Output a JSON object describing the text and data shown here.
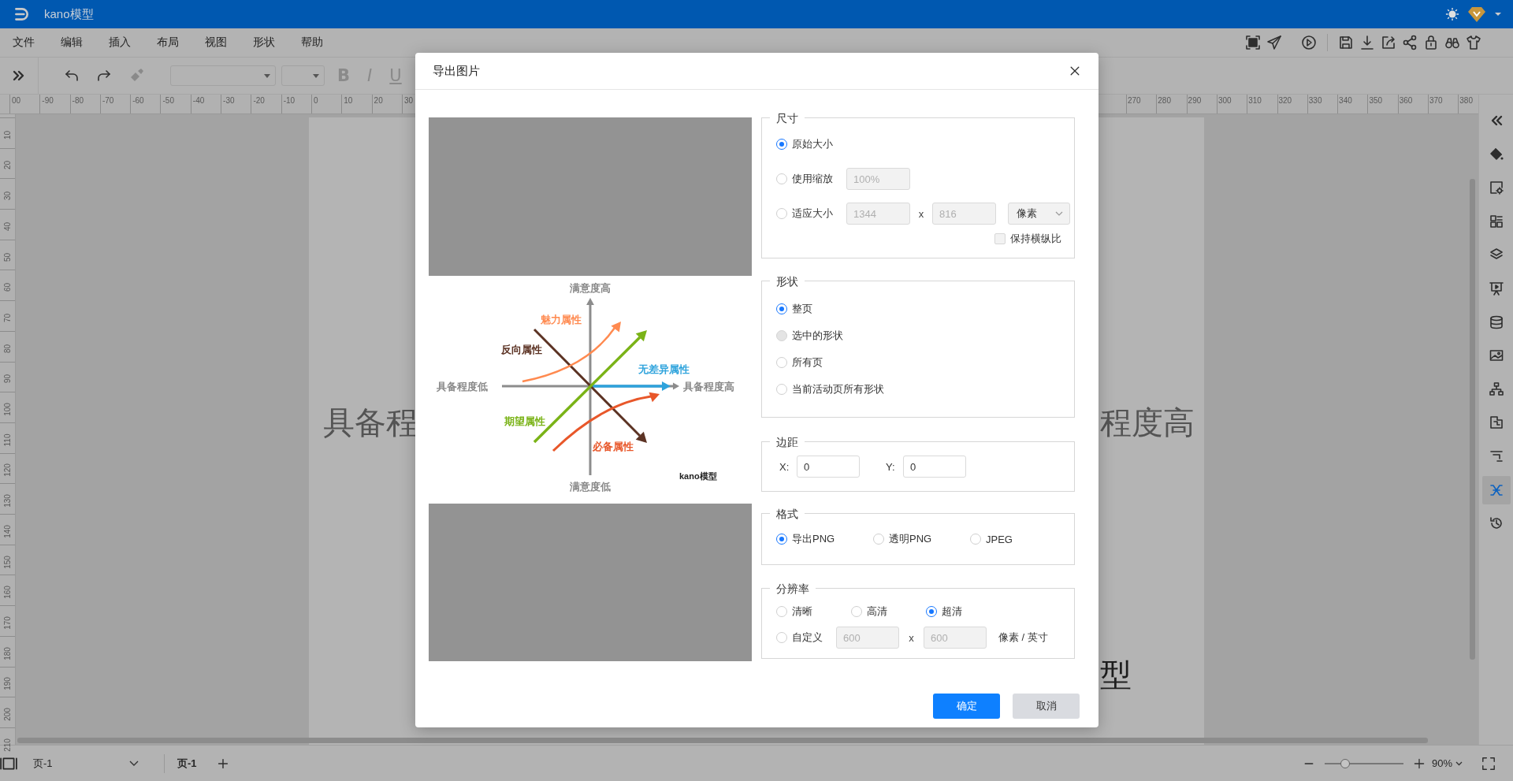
{
  "title_bar": {
    "app_title": "kano模型"
  },
  "menu_bar": {
    "items": [
      "文件",
      "编辑",
      "插入",
      "布局",
      "视图",
      "形状",
      "帮助"
    ]
  },
  "toolbar": {
    "format_buttons": [
      "B",
      "I",
      "U"
    ]
  },
  "horizontal_ruler": {
    "left_ticks": [
      "00",
      "-90",
      "-80",
      "-70",
      "-60",
      "-50",
      "-40",
      "-30",
      "-20",
      "-10",
      "0",
      "10",
      "20",
      "30"
    ],
    "right_ticks": [
      "270",
      "280",
      "290",
      "300",
      "310",
      "320",
      "330",
      "340",
      "350",
      "360",
      "370",
      "380"
    ]
  },
  "vertical_ruler": {
    "ticks": [
      "10",
      "20",
      "30",
      "40",
      "50",
      "60",
      "70",
      "80",
      "90",
      "100",
      "110",
      "120",
      "130",
      "140",
      "150",
      "160",
      "170",
      "180",
      "190",
      "200",
      "210"
    ]
  },
  "canvas": {
    "texts": [
      "具备程",
      "程度高",
      "型"
    ]
  },
  "right_sidebar": {
    "items": [
      {
        "selected": false
      },
      {
        "selected": false
      },
      {
        "selected": false
      },
      {
        "selected": false
      },
      {
        "selected": false
      },
      {
        "selected": false
      },
      {
        "selected": false
      },
      {
        "selected": false
      },
      {
        "selected": false
      },
      {
        "selected": false
      },
      {
        "selected": false
      },
      {
        "selected": true
      },
      {
        "selected": false
      }
    ]
  },
  "dialog": {
    "title": "导出图片",
    "preview": {
      "labels": [
        {
          "text": "满意度高",
          "color": "#8a8a8a"
        },
        {
          "text": "满意度低",
          "color": "#8a8a8a"
        },
        {
          "text": "具备程度低",
          "color": "#8a8a8a"
        },
        {
          "text": "具备程度高",
          "color": "#8a8a8a"
        },
        {
          "text": "魅力属性",
          "color": "#ff8a50"
        },
        {
          "text": "反向属性",
          "color": "#5c3324"
        },
        {
          "text": "无差异属性",
          "color": "#2ea3dc"
        },
        {
          "text": "期望属性",
          "color": "#7ab317"
        },
        {
          "text": "必备属性",
          "color": "#e8572a"
        },
        {
          "text": "kano模型",
          "color": "#222222"
        }
      ]
    },
    "size": {
      "legend": "尺寸",
      "options": [
        {
          "kind": "plain",
          "label": "原始大小",
          "selected": true
        },
        {
          "kind": "scale",
          "label": "使用缩放",
          "selected": false,
          "scale": {
            "value": "100%",
            "disabled": true
          }
        },
        {
          "kind": "fit",
          "label": "适应大小",
          "selected": false,
          "width": {
            "value": "1344",
            "disabled": true
          },
          "separator": "x",
          "height": {
            "value": "816",
            "disabled": true
          },
          "unit": "像素"
        }
      ],
      "keep_ratio": {
        "label": "保持横纵比",
        "checked": false
      }
    },
    "shape": {
      "legend": "形状",
      "options": [
        {
          "label": "整页",
          "selected": true,
          "disabled": false
        },
        {
          "label": "选中的形状",
          "selected": false,
          "disabled": true
        },
        {
          "label": "所有页",
          "selected": false,
          "disabled": false
        },
        {
          "label": "当前活动页所有形状",
          "selected": false,
          "disabled": false
        }
      ]
    },
    "margin": {
      "legend": "边距",
      "x_label": "X:",
      "x": {
        "value": "0",
        "disabled": false
      },
      "y_label": "Y:",
      "y": {
        "value": "0",
        "disabled": false
      }
    },
    "format": {
      "legend": "格式",
      "options": [
        {
          "label": "导出PNG",
          "selected": true
        },
        {
          "label": "透明PNG",
          "selected": false
        },
        {
          "label": "JPEG",
          "selected": false
        }
      ]
    },
    "resolution": {
      "legend": "分辨率",
      "options": [
        {
          "label": "清晰",
          "selected": false
        },
        {
          "label": "高清",
          "selected": false
        },
        {
          "label": "超清",
          "selected": true
        }
      ],
      "custom": {
        "label": "自定义",
        "selected": false,
        "width": {
          "value": "600",
          "disabled": true
        },
        "separator": "x",
        "height": {
          "value": "600",
          "disabled": true
        },
        "unit": "像素 / 英寸"
      }
    },
    "buttons": [
      {
        "label": "确定",
        "kind": "primary"
      },
      {
        "label": "取消",
        "kind": "secondary"
      }
    ]
  },
  "status_bar": {
    "page_select": "页-1",
    "page_tabs": [
      {
        "label": "页-1",
        "selected": true
      }
    ],
    "zoom": {
      "level": 0.26
    },
    "zoom_value": "90%"
  }
}
